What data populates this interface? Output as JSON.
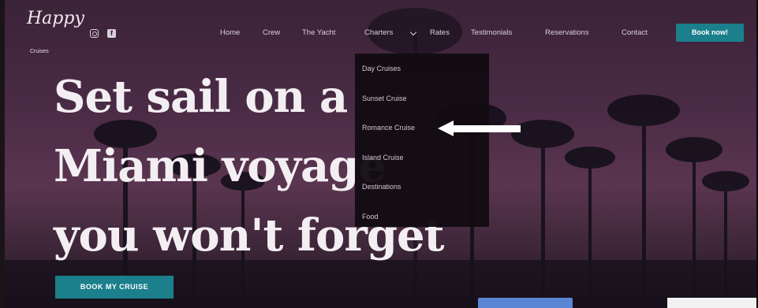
{
  "header": {
    "logo_text": "Happy",
    "logo_subtext": "Cruises",
    "nav": [
      "Home",
      "Crew",
      "The Yacht",
      "Charters",
      "Rates",
      "Testimonials",
      "Reservations",
      "Contact"
    ],
    "book_now_label": "Book now!"
  },
  "dropdown": {
    "items": [
      "Day Cruises",
      "Sunset Cruise",
      "Romance Cruise",
      "Island Cruise",
      "Destinations",
      "Food"
    ]
  },
  "hero": {
    "headline_lines": [
      "Set sail on a",
      "Miami voyage",
      "you won't forget"
    ],
    "cta_label": "BOOK MY CRUISE"
  },
  "colors": {
    "accent": "#1b7f8c",
    "dropdown_bg": "#120c12",
    "sky": "#4a2b45"
  },
  "icons": [
    "instagram-icon",
    "facebook-icon",
    "chevron-down-icon",
    "annotation-arrow-icon"
  ]
}
